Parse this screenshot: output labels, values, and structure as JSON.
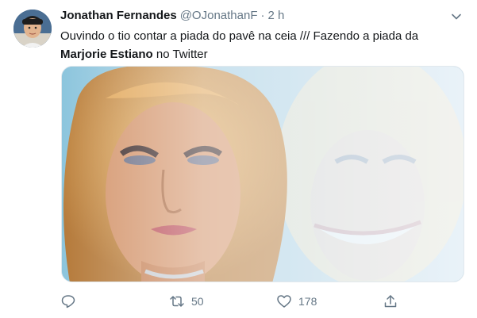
{
  "tweet": {
    "author_name": "Jonathan Fernandes",
    "handle": "@OJonathanF",
    "separator": "·",
    "time": "2 h",
    "text_line1": "Ouvindo o tio contar a piada do pavê na ceia /// Fazendo a piada da",
    "text_mention": "Marjorie Estiano",
    "text_line2_rest": " no Twitter"
  },
  "actions": {
    "reply_count": "",
    "retweet_count": "50",
    "like_count": "178"
  },
  "icons": {
    "reply": "reply-icon",
    "retweet": "retweet-icon",
    "like": "heart-icon",
    "share": "share-icon",
    "caret": "chevron-down-icon"
  },
  "colors": {
    "text": "#14171a",
    "secondary": "#657786",
    "border": "#e1e8ed"
  }
}
